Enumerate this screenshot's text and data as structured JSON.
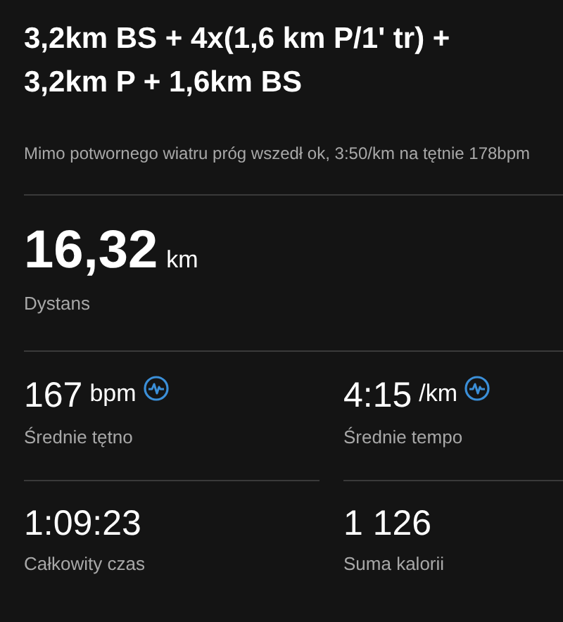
{
  "title": "3,2km BS + 4x(1,6 km P/1' tr) + 3,2km P + 1,6km BS",
  "description": "Mimo potwornego wiatru próg wszedł ok, 3:50/km na tętnie 178bpm",
  "distance": {
    "value": "16,32",
    "unit": "km",
    "label": "Dystans"
  },
  "stats": [
    {
      "value": "167",
      "unit": "bpm",
      "label": "Średnie tętno",
      "graph_icon": true
    },
    {
      "value": "4:15",
      "unit": "/km",
      "label": "Średnie tempo",
      "graph_icon": true
    },
    {
      "value": "1:09:23",
      "label": "Całkowity czas",
      "graph_icon": false
    },
    {
      "value": "1 126",
      "label": "Suma kalorii",
      "graph_icon": false
    }
  ]
}
